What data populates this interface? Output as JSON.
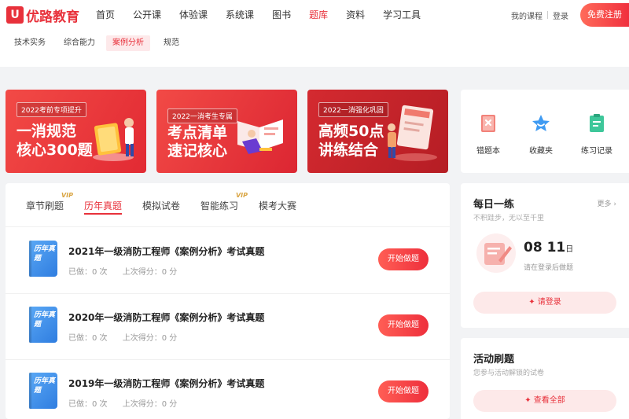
{
  "header": {
    "logo_mark": "U",
    "logo_text": "优路教育",
    "nav": [
      "首页",
      "公开课",
      "体验课",
      "系统课",
      "图书",
      "题库",
      "资料",
      "学习工具"
    ],
    "active_nav": "题库",
    "my_courses": "我的课程",
    "login": "登录",
    "register": "免费注册"
  },
  "subtabs": [
    "技术实务",
    "综合能力",
    "案例分析",
    "规范"
  ],
  "active_subtab": "案例分析",
  "banners": [
    {
      "tag": "2022考前专项提升",
      "line1": "一消规范",
      "line2": "核心300题"
    },
    {
      "tag": "2022一消考生专属",
      "line1": "考点清单",
      "line2": "速记核心"
    },
    {
      "tag": "2022一消强化巩固",
      "line1": "高频50点",
      "line2": "讲练结合"
    }
  ],
  "tools": [
    {
      "label": "错题本",
      "icon": "error-book-icon"
    },
    {
      "label": "收藏夹",
      "icon": "star-icon"
    },
    {
      "label": "练习记录",
      "icon": "record-icon"
    }
  ],
  "tabs": [
    {
      "label": "章节刷题",
      "vip": "VIP"
    },
    {
      "label": "历年真题",
      "vip": ""
    },
    {
      "label": "模拟试卷",
      "vip": ""
    },
    {
      "label": "智能练习",
      "vip": "VIP"
    },
    {
      "label": "模考大赛",
      "vip": ""
    }
  ],
  "active_tab": "历年真题",
  "book_label": "历年真题",
  "exams": [
    {
      "title": "2021年一级消防工程师《案例分析》考试真题",
      "done": "已做：0 次",
      "score": "上次得分：0 分",
      "button": "开始做题"
    },
    {
      "title": "2020年一级消防工程师《案例分析》考试真题",
      "done": "已做：0 次",
      "score": "上次得分：0 分",
      "button": "开始做题"
    },
    {
      "title": "2019年一级消防工程师《案例分析》考试真题",
      "done": "已做：0 次",
      "score": "上次得分：0 分",
      "button": "开始做题"
    }
  ],
  "daily": {
    "title": "每日一练",
    "subtitle": "不积跬步，无以至千里",
    "more": "更多 ›",
    "month": "08",
    "day": "11",
    "day_unit": "日",
    "note": "请在登录后做题",
    "button": "请登录"
  },
  "activity": {
    "title": "活动刷题",
    "subtitle": "您参与活动解锁的试卷",
    "button": "查看全部"
  },
  "colors": {
    "accent": "#e8313b",
    "book": "#3a8ae8"
  }
}
